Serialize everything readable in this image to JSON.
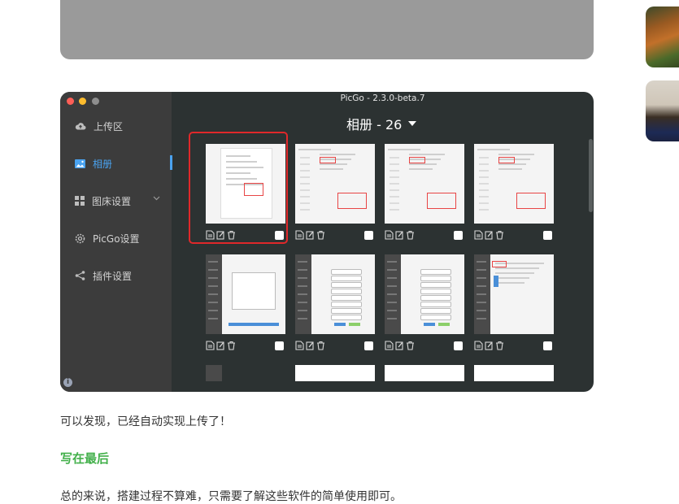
{
  "picgo": {
    "window_title": "PicGo - 2.3.0-beta.7",
    "album_title": "相册 - 26",
    "nav": [
      {
        "label": "上传区",
        "icon": "cloud-upload-icon"
      },
      {
        "label": "相册",
        "icon": "image-icon"
      },
      {
        "label": "图床设置",
        "icon": "grid-icon"
      },
      {
        "label": "PicGo设置",
        "icon": "gear-icon"
      },
      {
        "label": "插件设置",
        "icon": "share-icon"
      }
    ],
    "active_nav": "相册"
  },
  "article": {
    "paragraph_1": "可以发现，已经自动实现上传了！",
    "heading": "写在最后",
    "paragraph_2": "总的来说，搭建过程不算难，只需要了解这些软件的简单使用即可。"
  },
  "colors": {
    "accent": "#4aa3f0",
    "heading_green": "#42b04a",
    "highlight_red": "#e0282a"
  }
}
